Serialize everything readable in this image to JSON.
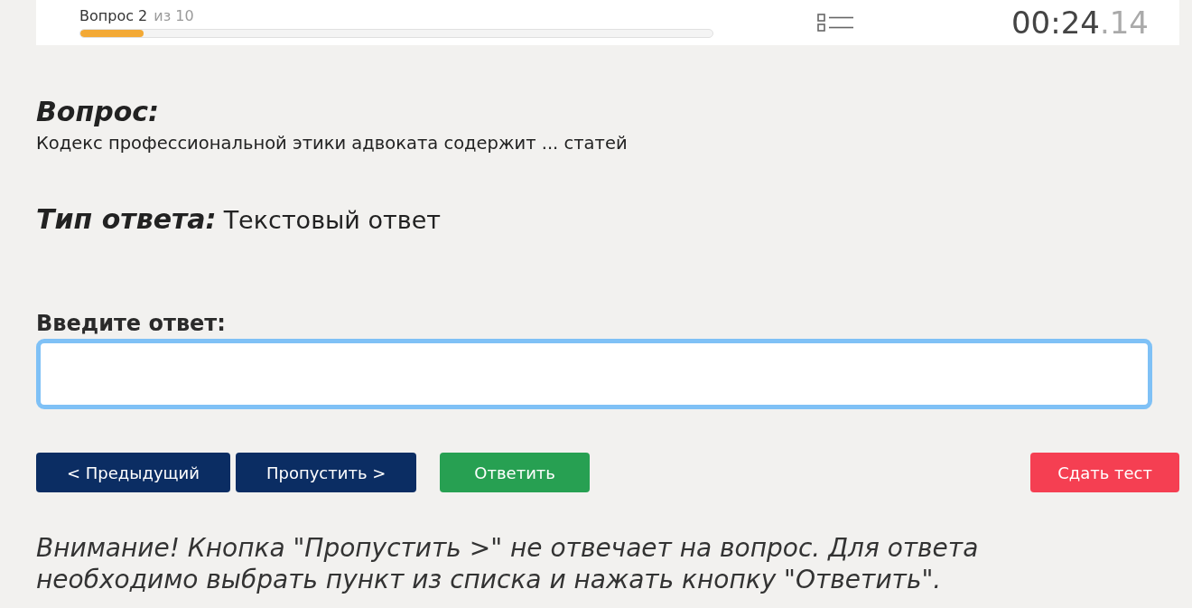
{
  "header": {
    "counter": "Вопрос 2",
    "total": "из 10",
    "progress": {
      "level": 0.1
    },
    "timer": {
      "main": "00:24",
      "fraction": ".14"
    }
  },
  "question": {
    "label": "Вопрос:",
    "text": "Кодекс профессиональной этики адвоката содержит ... статей"
  },
  "answer_type": {
    "label": "Тип ответа:",
    "value": "Текстовый ответ"
  },
  "answer_field": {
    "label": "Введите ответ:",
    "focused": true
  },
  "buttons": [
    {
      "label": "< Предыдущий",
      "kind": "primary"
    },
    {
      "label": "Пропустить >",
      "kind": "primary"
    },
    {
      "label": "Ответить",
      "kind": "success"
    },
    {
      "label": "Сдать тест",
      "kind": "danger"
    }
  ],
  "notice": "Внимание! Кнопка \"Пропустить >\" не отвечает на вопрос. Для ответа необходимо выбрать пункт из списка и нажать кнопку \"Ответить\"."
}
